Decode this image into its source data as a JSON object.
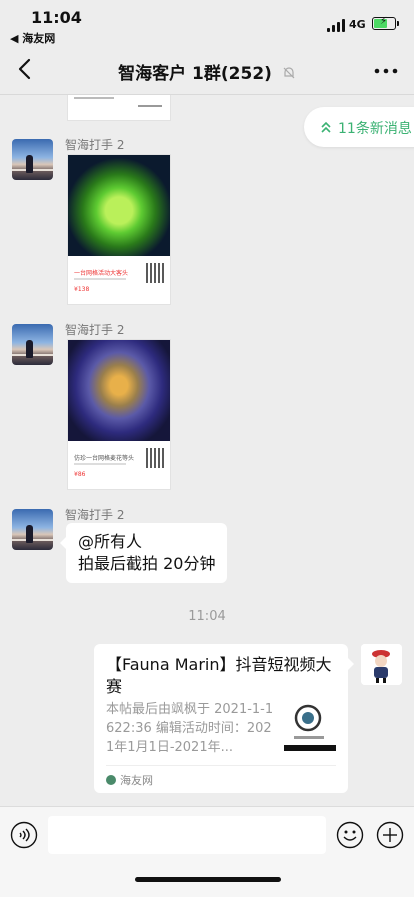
{
  "status_bar": {
    "time": "11:04",
    "back_app": "◀ 海友网",
    "network": "4G"
  },
  "nav": {
    "title": "智海客户 1群(252)"
  },
  "new_messages": {
    "label": "11条新消息"
  },
  "messages": [
    {
      "sender": "智海打手 2",
      "type": "product-card",
      "caption": "一台网格活动大客头",
      "price": "¥138"
    },
    {
      "sender": "智海打手 2",
      "type": "product-card",
      "caption": "仿珍一台网格麦花等头",
      "price": "¥86"
    },
    {
      "sender": "智海打手 2",
      "type": "text",
      "lines": [
        "@所有人",
        "拍最后截拍 20分钟"
      ]
    }
  ],
  "timestamp": "11:04",
  "link_card": {
    "title": "【Fauna Marin】抖音短视频大赛",
    "desc": "本帖最后由飒枫于 2021-1-1622:36 编辑活动时间：2021年1月1日-2021年...",
    "source": "海友网"
  },
  "colors": {
    "accent_green": "#3bb273",
    "bubble": "#ffffff",
    "background": "#ededed"
  }
}
